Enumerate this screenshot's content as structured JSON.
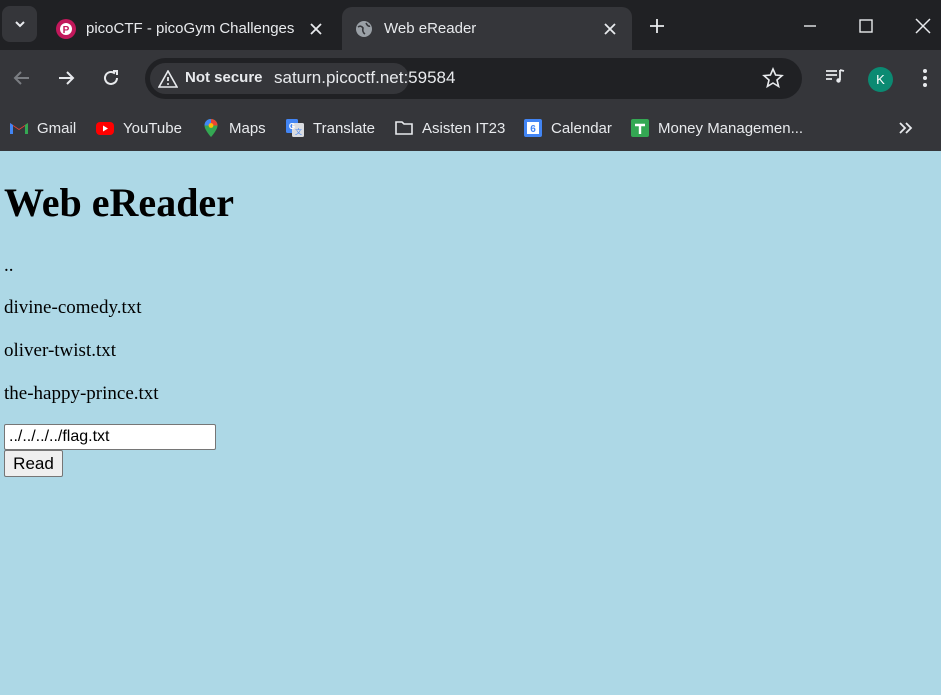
{
  "browser": {
    "tabs": [
      {
        "title": "picoCTF - picoGym Challenges",
        "active": false,
        "favicon": "picoctf-icon"
      },
      {
        "title": "Web eReader",
        "active": true,
        "favicon": "globe-icon"
      }
    ],
    "security_label": "Not secure",
    "url": "saturn.picoctf.net:59584",
    "avatar_initial": "K",
    "bookmarks": [
      {
        "label": "Gmail",
        "icon": "gmail-icon"
      },
      {
        "label": "YouTube",
        "icon": "youtube-icon"
      },
      {
        "label": "Maps",
        "icon": "maps-icon"
      },
      {
        "label": "Translate",
        "icon": "translate-icon"
      },
      {
        "label": "Asisten IT23",
        "icon": "folder-icon"
      },
      {
        "label": "Calendar",
        "icon": "calendar-icon"
      },
      {
        "label": "Money Managemen...",
        "icon": "sheets-icon"
      }
    ],
    "calendar_day": "6",
    "colors": {
      "tabstrip": "#202124",
      "toolbar": "#35363a",
      "text": "#e8eaed",
      "avatar": "#0b8a72"
    }
  },
  "page": {
    "title": "Web eReader",
    "files": [
      "..",
      "divine-comedy.txt",
      "oliver-twist.txt",
      "the-happy-prince.txt"
    ],
    "input_value": "../../../../flag.txt",
    "read_button": "Read",
    "background": "#add8e6"
  }
}
